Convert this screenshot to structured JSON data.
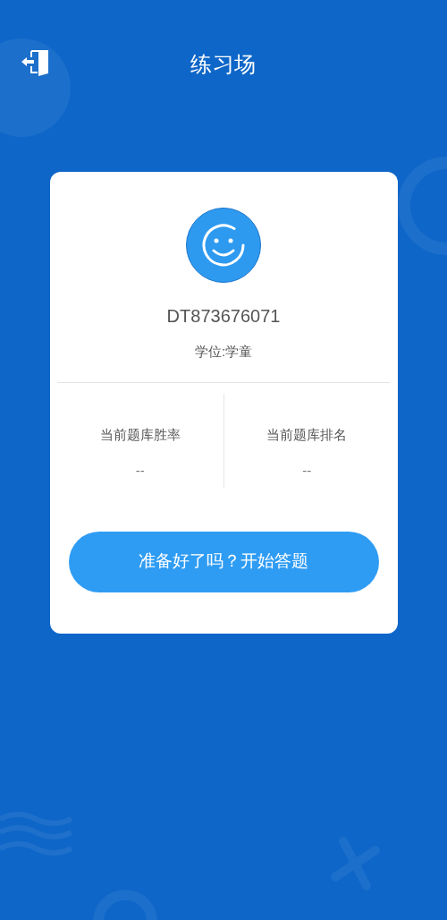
{
  "header": {
    "title": "练习场"
  },
  "profile": {
    "username": "DT873676071",
    "degree": "学位:学童"
  },
  "stats": [
    {
      "label": "当前题库胜率",
      "value": "--"
    },
    {
      "label": "当前题库排名",
      "value": "--"
    }
  ],
  "start_button": {
    "label": "准备好了吗？开始答题"
  }
}
